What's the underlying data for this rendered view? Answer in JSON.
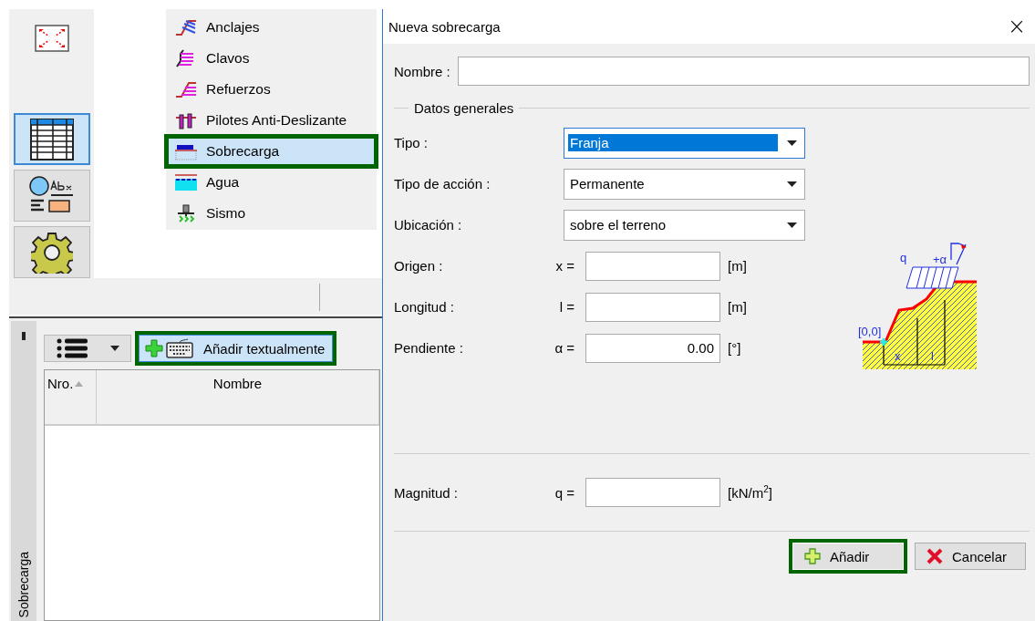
{
  "sidebar": {
    "buttons": [
      {
        "kind": "expand",
        "selected": false
      },
      {
        "kind": "table",
        "selected": true
      },
      {
        "kind": "abc",
        "selected": false
      },
      {
        "kind": "gear",
        "selected": false
      }
    ]
  },
  "menu": {
    "items": [
      {
        "kind": "anchor",
        "label": "Anclajes",
        "selected": false,
        "highlighted": false
      },
      {
        "kind": "nail",
        "label": "Clavos",
        "selected": false,
        "highlighted": false
      },
      {
        "kind": "reinforcement",
        "label": "Refuerzos",
        "selected": false,
        "highlighted": false
      },
      {
        "kind": "pile",
        "label": "Pilotes Anti-Deslizante",
        "selected": false,
        "highlighted": false
      },
      {
        "kind": "surcharge",
        "label": "Sobrecarga",
        "selected": true,
        "highlighted": true
      },
      {
        "kind": "water",
        "label": "Agua",
        "selected": false,
        "highlighted": false
      },
      {
        "kind": "earthquake",
        "label": "Sismo",
        "selected": false,
        "highlighted": false
      }
    ]
  },
  "lower_panel": {
    "tab": "Sobrecarga",
    "add_button": {
      "label": "Añadir textualmente",
      "highlighted": true
    },
    "table": {
      "columns": [
        {
          "label": "Nro.",
          "sorted": true
        },
        {
          "label": "Nombre",
          "sorted": false
        }
      ]
    }
  },
  "dialog": {
    "title": "Nueva sobrecarga",
    "close": "×",
    "name_label": "Nombre :",
    "group": "Datos generales",
    "selects": [
      {
        "label": "Tipo :",
        "value": "Franja",
        "focused": true
      },
      {
        "label": "Tipo de acción :",
        "value": "Permanente",
        "focused": false
      },
      {
        "label": "Ubicación :",
        "value": "sobre el terreno",
        "focused": false
      }
    ],
    "fields": [
      {
        "label": "Origen :",
        "symbol": "x =",
        "unit": "[m]"
      },
      {
        "label": "Longitud :",
        "symbol": "l =",
        "unit": "[m]"
      },
      {
        "label": "Pendiente :",
        "symbol": "α =",
        "value": "0.00",
        "unit": "[°]"
      }
    ],
    "diagram": {
      "labels": [
        "q",
        "+α",
        "[0,0]",
        "x",
        "l"
      ]
    },
    "magnitude": {
      "label": "Magnitud :",
      "symbol": "q =",
      "unit": "[kN/m$^{2}$]"
    },
    "buttons": [
      {
        "kind": "add",
        "label": "Añadir",
        "highlighted": true
      },
      {
        "kind": "cancel",
        "label": "Cancelar",
        "highlighted": false
      }
    ]
  }
}
